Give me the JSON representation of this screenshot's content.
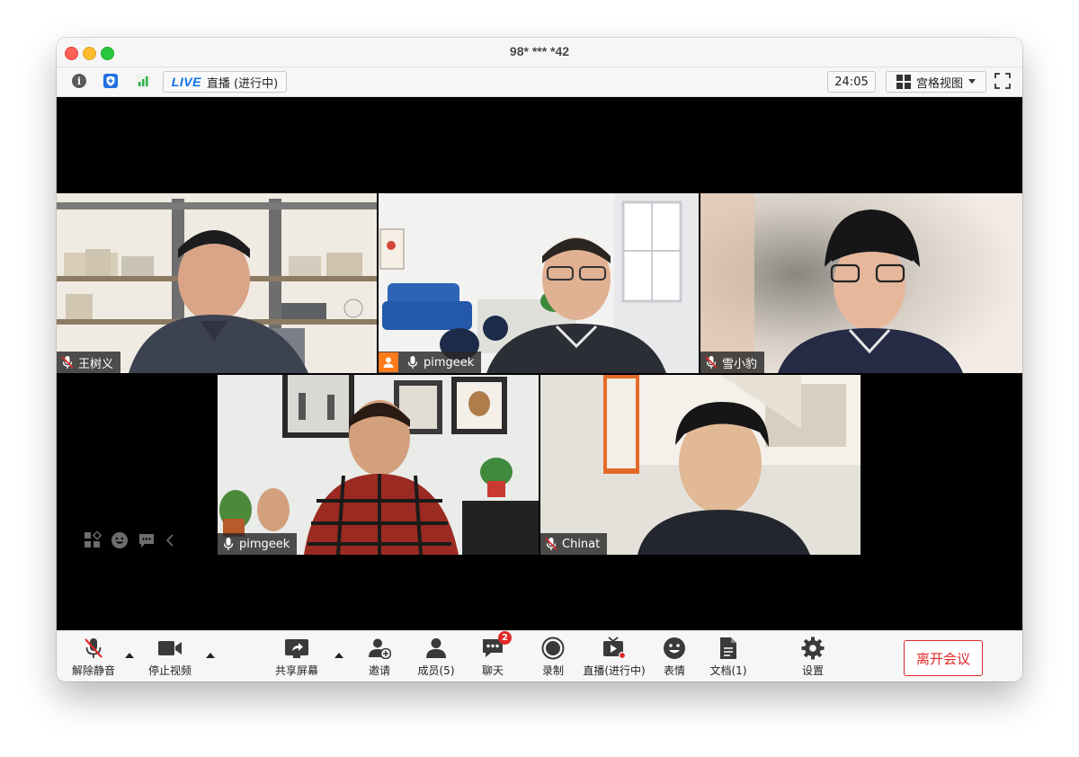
{
  "window": {
    "title": "98* *** *42"
  },
  "infobar": {
    "live_word": "LIVE",
    "live_status": "直播 (进行中)",
    "timer": "24:05",
    "view_mode": "宫格视图"
  },
  "participants": [
    {
      "name": "王树义",
      "muted": true
    },
    {
      "name": "pimgeek",
      "muted": false
    },
    {
      "name": "雪小豹",
      "muted": true
    },
    {
      "name": "pimgeek",
      "muted": false,
      "active_speaker": true
    },
    {
      "name": "Chinat",
      "muted": true
    }
  ],
  "toolbar": {
    "unmute": "解除静音",
    "stop_video": "停止视频",
    "share_screen": "共享屏幕",
    "invite": "邀请",
    "participants": "成员(5)",
    "chat": "聊天",
    "chat_badge": "2",
    "record": "录制",
    "livestream": "直播(进行中)",
    "reactions": "表情",
    "docs": "文档(1)",
    "settings": "设置",
    "leave": "离开会议"
  },
  "colors": {
    "live_blue": "#0e72ed",
    "leave_red": "#e02828",
    "active_green": "#23d959",
    "badge_red": "#e02828"
  }
}
